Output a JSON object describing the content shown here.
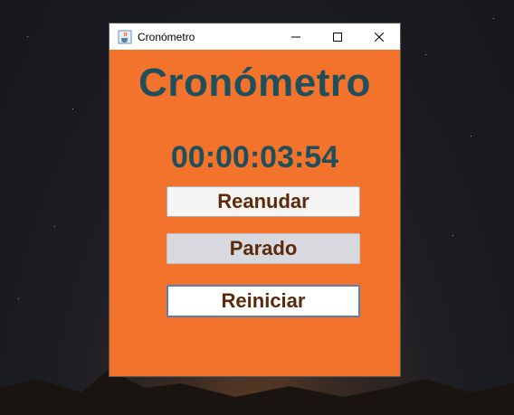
{
  "window": {
    "title": "Cronómetro",
    "controls": [
      "minimize-icon",
      "maximize-icon",
      "close-icon"
    ]
  },
  "app": {
    "heading": "Cronómetro",
    "time": "00:00:03:54",
    "buttons": {
      "resume": "Reanudar",
      "stop": "Parado",
      "reset": "Reiniciar"
    }
  },
  "colors": {
    "background": "#f3722c",
    "heading": "#1f4f5a",
    "button_text": "#5a2a0a"
  }
}
